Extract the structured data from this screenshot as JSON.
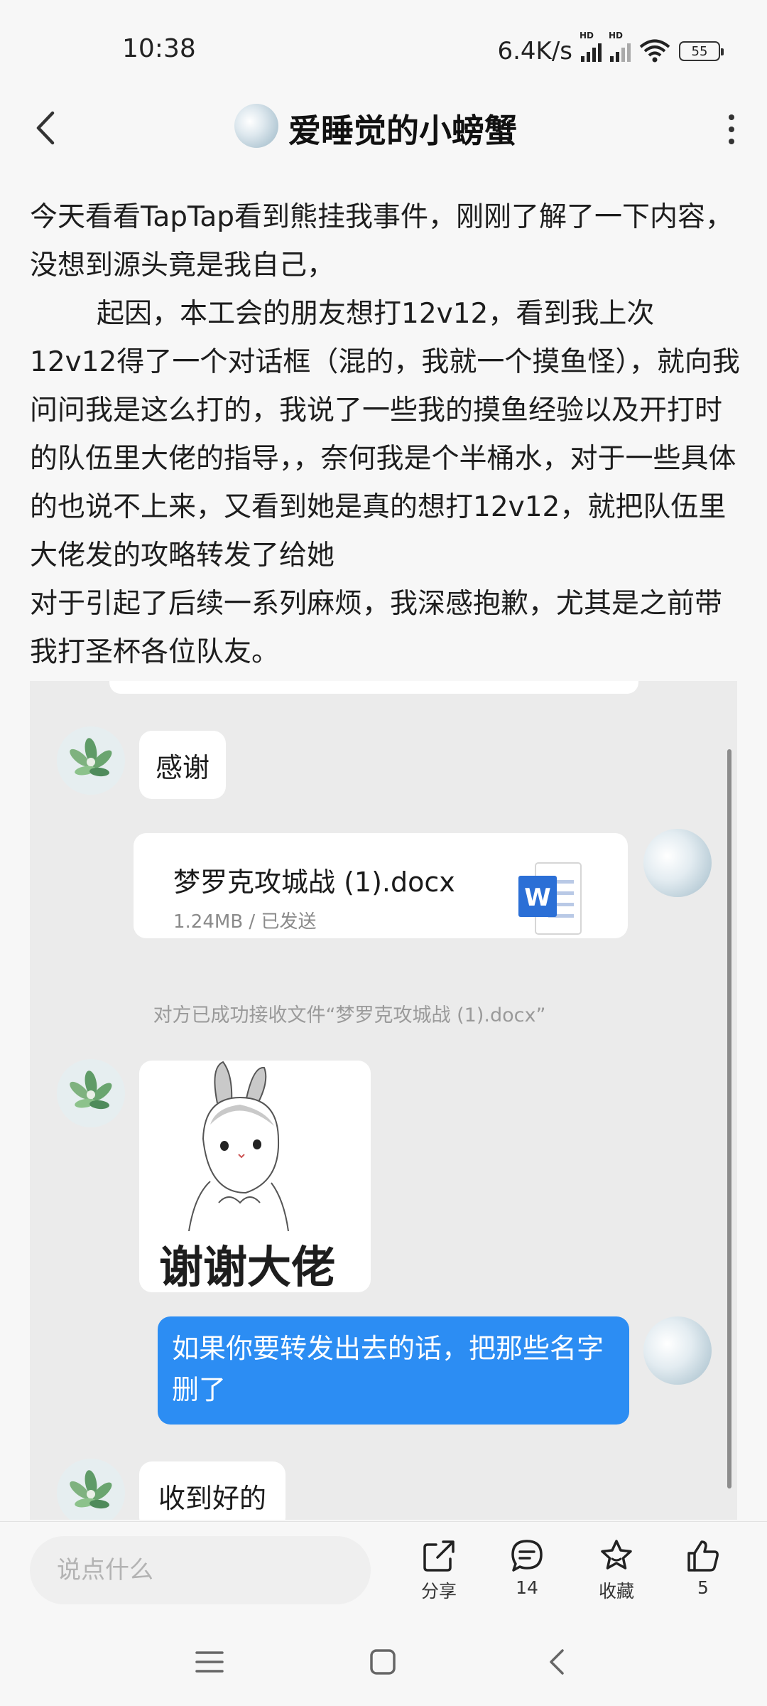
{
  "status": {
    "time": "10:38",
    "network_speed": "6.4K/s",
    "battery": "55"
  },
  "header": {
    "title": "爱睡觉的小螃蟹"
  },
  "post": {
    "paragraphs": [
      "今天看看TapTap看到熊挂我事件，刚刚了解了一下内容，没想到源头竟是我自己，",
      "起因，本工会的朋友想打12v12，看到我上次12v12得了一个对话框（混的，我就一个摸鱼怪），就向我问问我是这么打的，我说了一些我的摸鱼经验以及开打时的队伍里大佬的指导，，奈何我是个半桶水，对于一些具体的也说不上来，又看到她是真的想打12v12，就把队伍里大佬发的攻略转发了给她",
      "对于引起了后续一系列麻烦，我深感抱歉，尤其是之前带我打圣杯各位队友。"
    ]
  },
  "chat": {
    "msg_thanks": "感谢",
    "file_name": "梦罗克攻城战 (1).docx",
    "file_meta": "1.24MB / 已发送",
    "system_note": "对方已成功接收文件“梦罗克攻城战 (1).docx”",
    "sticker_text": "谢谢大佬",
    "msg_forward": "如果你要转发出去的话，把那些名字删了",
    "msg_received": "收到好的"
  },
  "bottom": {
    "comment_placeholder": "说点什么",
    "share_label": "分享",
    "comment_count": "14",
    "favorite_label": "收藏",
    "like_count": "5"
  },
  "colors": {
    "blue_bubble": "#2c8df3",
    "word_blue": "#2b6fd6"
  }
}
